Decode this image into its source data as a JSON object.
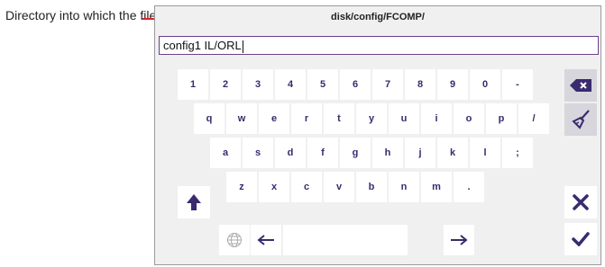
{
  "annotation": {
    "text": "Directory into which the file will be saved"
  },
  "path_title": "disk/config/FCOMP/",
  "filename_field": {
    "value": "config1 IL/ORL"
  },
  "rows": {
    "row1": [
      "1",
      "2",
      "3",
      "4",
      "5",
      "6",
      "7",
      "8",
      "9",
      "0",
      "-"
    ],
    "row2": [
      "q",
      "w",
      "e",
      "r",
      "t",
      "y",
      "u",
      "i",
      "o",
      "p",
      "/"
    ],
    "row3": [
      "a",
      "s",
      "d",
      "f",
      "g",
      "h",
      "j",
      "k",
      "l",
      ";"
    ],
    "row4": [
      "z",
      "x",
      "c",
      "v",
      "b",
      "n",
      "m",
      "."
    ]
  },
  "icons": {
    "backspace": "backspace-icon",
    "clear": "broom-icon",
    "shift": "shift-up-arrow-icon",
    "cancel": "close-x-icon",
    "confirm": "checkmark-icon",
    "language": "globe-icon",
    "left": "left-arrow-icon",
    "right": "right-arrow-icon"
  },
  "colors": {
    "accent": "#3a2a6e",
    "annotation": "#e0202a",
    "field_border": "#6b3f8a"
  }
}
